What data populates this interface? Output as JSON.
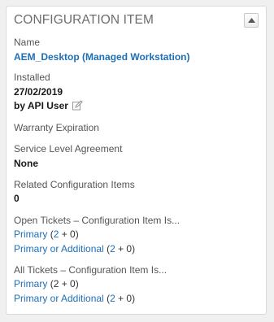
{
  "panel": {
    "title": "CONFIGURATION ITEM",
    "collapse_icon": "caret-up-icon"
  },
  "name": {
    "label": "Name",
    "value": "AEM_Desktop (Managed Workstation)"
  },
  "installed": {
    "label": "Installed",
    "date": "27/02/2019",
    "by": "by API User",
    "edit_icon": "edit-icon"
  },
  "warranty": {
    "label": "Warranty Expiration"
  },
  "sla": {
    "label": "Service Level Agreement",
    "value": "None"
  },
  "related": {
    "label": "Related Configuration Items",
    "value": "0"
  },
  "open_tickets": {
    "label": "Open Tickets – Configuration Item Is...",
    "primary": {
      "label": "Primary",
      "open": "(",
      "n1": "2",
      "rest": " + 0)"
    },
    "primary_or_additional": {
      "label": "Primary or Additional",
      "open": "(",
      "n1": "2",
      "rest": " + 0)"
    }
  },
  "all_tickets": {
    "label": "All Tickets – Configuration Item Is...",
    "primary": {
      "label": "Primary",
      "open": "(",
      "n1": "2",
      "rest": " + 0)"
    },
    "primary_or_additional": {
      "label": "Primary or Additional",
      "open": "(",
      "n1": "2",
      "rest": " + 0)"
    }
  },
  "colors": {
    "link": "#1f6fb5",
    "label": "#555555",
    "title": "#6d6d6d"
  }
}
